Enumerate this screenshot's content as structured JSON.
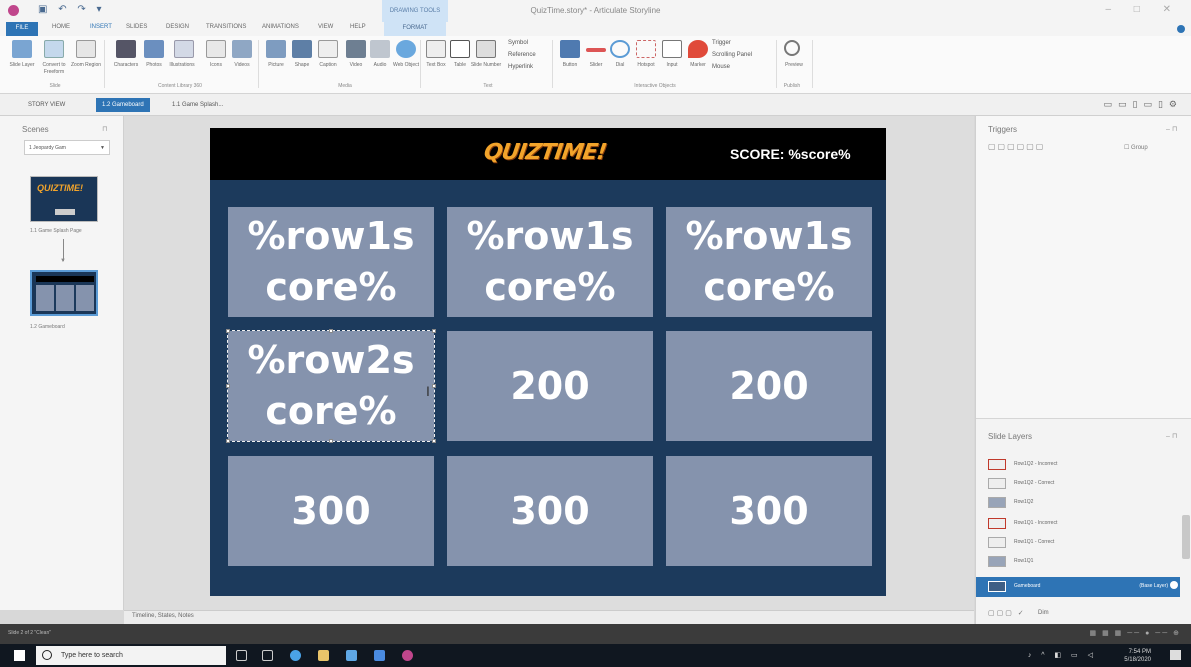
{
  "app": {
    "window_title": "QuizTime.story* - Articulate Storyline",
    "context_tab_group": "DRAWING TOOLS"
  },
  "ribbon_tabs": [
    "FILE",
    "HOME",
    "INSERT",
    "SLIDES",
    "DESIGN",
    "TRANSITIONS",
    "ANIMATIONS",
    "VIEW",
    "HELP"
  ],
  "ribbon_format_tab": "FORMAT",
  "ribbon": {
    "buttons": [
      "Slide Layer",
      "Convert to Freeform",
      "Zoom Region",
      "Characters",
      "Photos",
      "Illustrations",
      "Icons",
      "Videos",
      "Picture",
      "Shape",
      "Caption",
      "Video",
      "Audio",
      "Web Object",
      "Text Box",
      "Table",
      "Slide Number",
      "Button",
      "Slider",
      "Dial",
      "Hotspot",
      "Input",
      "Marker",
      "Preview"
    ],
    "small_commands": [
      "Symbol",
      "Reference",
      "Hyperlink",
      "Trigger",
      "Scrolling Panel",
      "Mouse"
    ],
    "groups": [
      "Slide",
      "Content Library 360",
      "Media",
      "Text",
      "Interactive Objects",
      "Publish"
    ]
  },
  "view_tabs": [
    "STORY VIEW",
    "1.2 Gameboard",
    "1.1 Game Splash..."
  ],
  "scenes": {
    "title": "Scenes",
    "dropdown_value": "1 Jeopardy Gam",
    "thumb1_label": "1.1 Game Splash Page",
    "thumb2_label": "1.2 Gameboard",
    "thumb1_logo": "QUIZTIME!"
  },
  "slide": {
    "logo_text": "QUIZTIME!",
    "score_text": "SCORE: %score%",
    "tiles": [
      [
        "%row1s core%",
        "%row1s core%",
        "%row1s core%"
      ],
      [
        "%row2s core%",
        "200",
        "200"
      ],
      [
        "300",
        "300",
        "300"
      ]
    ]
  },
  "timeline_label": "Timeline, States, Notes",
  "triggers": {
    "title": "Triggers",
    "group_label": "Group"
  },
  "slide_layers": {
    "title": "Slide Layers",
    "items": [
      {
        "name": "Row1Q2 - Incorrect",
        "type": "red"
      },
      {
        "name": "Row1Q2 - Correct",
        "type": "plain"
      },
      {
        "name": "Row1Q2",
        "type": "solid"
      },
      {
        "name": "Row1Q1 - Incorrect",
        "type": "red"
      },
      {
        "name": "Row1Q1 - Correct",
        "type": "plain"
      },
      {
        "name": "Row1Q1",
        "type": "solid"
      }
    ],
    "base_layer": {
      "name": "Gameboard",
      "badge": "(Base Layer)"
    },
    "dim_label": "Dim"
  },
  "status": {
    "left": "Slide 2 of 2   \"Clean\""
  },
  "taskbar": {
    "search_placeholder": "Type here to search",
    "time": "7:54 PM",
    "date": "5/18/2020"
  },
  "colors": {
    "accent": "#2e74b5",
    "slide_bg": "#1c3a5c",
    "tile": "#8593ad",
    "logo": "#f2a42b"
  }
}
